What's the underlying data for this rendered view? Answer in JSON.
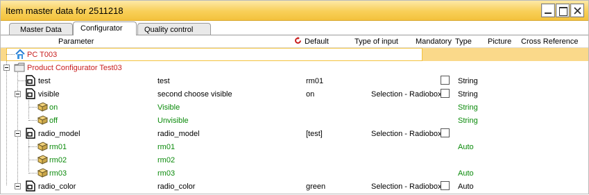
{
  "window": {
    "title": "Item master data for 2511218"
  },
  "tabs": [
    {
      "label": "Master Data"
    },
    {
      "label": "Configurator"
    },
    {
      "label": "Quality control"
    }
  ],
  "columns": {
    "parameter": "Parameter",
    "default": "Default",
    "type_of_input": "Type of input",
    "mandatory": "Mandatory",
    "type": "Type",
    "picture": "Picture",
    "cross_reference": "Cross Reference"
  },
  "rows": [
    {
      "param": "PC T003",
      "desc": "",
      "default": "",
      "input": "",
      "type": "",
      "style": "red",
      "icon": "home-icon"
    },
    {
      "param": "Product Configurator Test03",
      "desc": "",
      "default": "",
      "input": "",
      "type": "",
      "style": "red",
      "icon": "folder-icon"
    },
    {
      "param": "test",
      "desc": "test",
      "default": "rm01",
      "input": "",
      "type": "String",
      "style": "normal",
      "icon": "document-icon"
    },
    {
      "param": "visible",
      "desc": "second choose visible",
      "default": "on",
      "input": "Selection - Radiobox",
      "type": "String",
      "style": "normal",
      "icon": "document-icon"
    },
    {
      "param": "on",
      "desc": "Visible",
      "default": "",
      "input": "",
      "type": "String",
      "style": "green",
      "icon": "box-icon"
    },
    {
      "param": "off",
      "desc": "Unvisible",
      "default": "",
      "input": "",
      "type": "String",
      "style": "green",
      "icon": "box-icon"
    },
    {
      "param": "radio_model",
      "desc": "radio_model",
      "default": "[test]",
      "input": "Selection - Radiobox",
      "type": "",
      "style": "normal",
      "icon": "document-icon"
    },
    {
      "param": "rm01",
      "desc": "rm01",
      "default": "",
      "input": "",
      "type": "Auto",
      "style": "green",
      "icon": "box-icon"
    },
    {
      "param": "rm02",
      "desc": "rm02",
      "default": "",
      "input": "",
      "type": "",
      "style": "green",
      "icon": "box-icon"
    },
    {
      "param": "rm03",
      "desc": "rm03",
      "default": "",
      "input": "",
      "type": "Auto",
      "style": "green",
      "icon": "box-icon"
    },
    {
      "param": "radio_color",
      "desc": "radio_color",
      "default": "green",
      "input": "Selection - Radiobox",
      "type": "Auto",
      "style": "normal",
      "icon": "document-icon"
    }
  ],
  "colors": {
    "title_bar": "#f8cf58",
    "selection": "#fad98a",
    "value_green": "#0a8a0a",
    "value_red": "#c81e1e"
  }
}
